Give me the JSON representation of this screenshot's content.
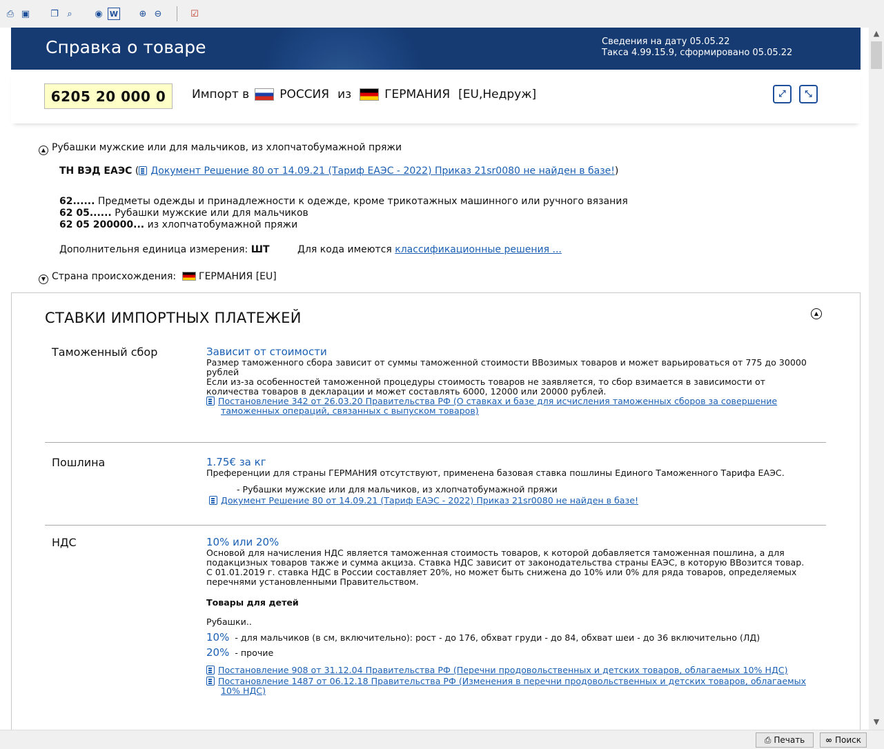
{
  "toolbar": {
    "icons": [
      "print-icon",
      "save-icon",
      "copy-icon",
      "find-icon",
      "browser-icon",
      "word-icon",
      "zoom-in-icon",
      "zoom-out-icon",
      "export-icon"
    ]
  },
  "header": {
    "title": "Справка о товаре",
    "info_line1": "Сведения на дату 05.05.22",
    "info_line2": "Такса 4.99.15.9, сформировано 05.05.22"
  },
  "code_row": {
    "code": "6205 20 000 0",
    "import_label": "Импорт в",
    "to_country": "РОССИЯ",
    "from_label": "из",
    "from_country": "ГЕРМАНИЯ",
    "from_tags": "[EU,Недруж]"
  },
  "desc": {
    "product": "Рубашки мужские или для мальчиков, из хлопчатобумажной пряжи",
    "tn_label": "ТН ВЭД ЕАЭС",
    "tn_link": "Документ Решение 80 от 14.09.21 (Тариф ЕАЭС - 2022) Приказ 21sr0080 не найден в базе!",
    "hierarchy": [
      {
        "code": "62......",
        "text": "Предметы одежды и принадлежности к одежде, кроме трикотажных машинного или ручного вязания"
      },
      {
        "code": "62 05......",
        "text": "Рубашки мужские или для мальчиков"
      },
      {
        "code": "62 05 200000...",
        "text": "из хлопчатобумажной пряжи"
      }
    ],
    "unit_label": "Дополнительня единица измерения:",
    "unit_value": "ШТ",
    "class_label": "Для кода имеются",
    "class_link": "классификационные решения ...",
    "origin_label": "Страна происхождения:",
    "origin_country": "ГЕРМАНИЯ [EU]"
  },
  "payments": {
    "title": "СТАВКИ ИМПОРТНЫХ ПЛАТЕЖЕЙ",
    "fee": {
      "label": "Таможенный сбор",
      "rate": "Зависит от стоимости",
      "line1": "Размер таможенного сбора зависит от суммы таможенной стоимости ВВозимых товаров и может варьироваться от 775 до 30000",
      "line2": "рублей",
      "line3": "Если из-за особенностей таможенной процедуры стоимость товаров не заявляется, то сбор взимается в зависимости от",
      "line4": "количества товаров в декларации и может составлять 6000, 12000 или 20000 рублей.",
      "link1": "Постановление 342 от 26.03.20 Правительства РФ (О ставках и базе для исчисления таможенных сборов за совершение",
      "link2": "таможенных операций, связанных с выпуском товаров)"
    },
    "duty": {
      "label": "Пошлина",
      "rate": "1.75€ за кг",
      "line1": "Преференции для страны ГЕРМАНИЯ отсутствуют, применена базовая ставка пошлины Единого Таможенного Тарифа ЕАЭС.",
      "sub": "- Рубашки мужские или для мальчиков, из хлопчатобумажной пряжи",
      "link": "Документ Решение 80 от 14.09.21 (Тариф ЕАЭС - 2022) Приказ 21sr0080 не найден в базе!"
    },
    "vat": {
      "label": "НДС",
      "rate": "10% или 20%",
      "line1": "Основой для начисления НДС является таможенная стоимость товаров, к которой добавляется таможенная пошлина, а для",
      "line2": "подакцизных товаров также и сумма акциза. Ставка НДС зависит от законодательства страны ЕАЭС, в которую ВВозится товар.",
      "line3": "С 01.01.2019 г. ставка НДС в России составляет 20%, но может быть снижена до 10% или 0% для ряда товаров, определяемых",
      "line4": "перечнями установленными Правительством.",
      "kids_title": "Товары для детей",
      "item": "Рубашки..",
      "r1": "10%",
      "r1_text": "- для мальчиков (в см, включительно): рост - до 176, обхват груди - до 84, обхват шеи - до 36 включительно (ЛД)",
      "r2": "20%",
      "r2_text": "- прочие",
      "link1": "Постановление 908 от 31.12.04 Правительства РФ (Перечни продовольственных и детских товаров, облагаемых 10% НДС)",
      "link2a": "Постановление 1487 от 06.12.18 Правительства РФ (Изменения в перечни продовольственных и детских товаров, облагаемых",
      "link2b": "10% НДС)"
    }
  },
  "bottom": {
    "print": "Печать",
    "search": "Поиск"
  },
  "colors": {
    "header_bg": "#163b73",
    "link": "#1a5fb4",
    "code_bg": "#ffffc8"
  }
}
